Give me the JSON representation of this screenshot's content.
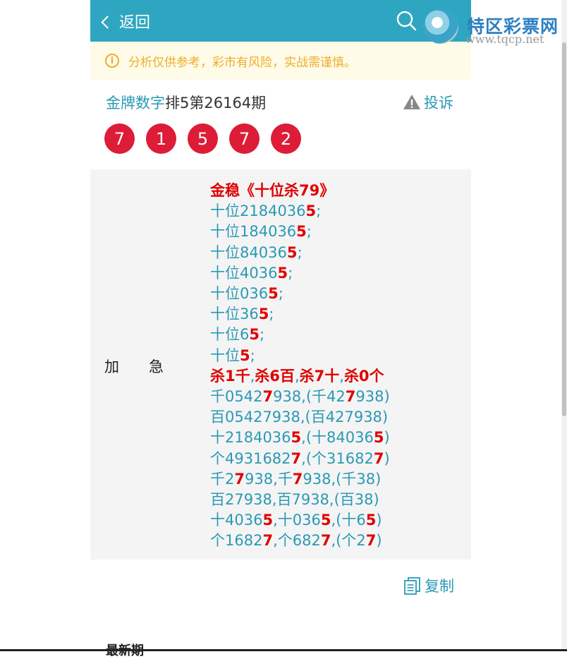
{
  "header": {
    "back_label": "返回"
  },
  "logo": {
    "name": "特区彩票网",
    "url": "www.tqcp.net"
  },
  "notice": {
    "text": "分析仅供参考，彩市有风险，实战需谨慎。"
  },
  "title": {
    "source": "金牌数字",
    "rest": "排5第26164期"
  },
  "complain_label": "投诉",
  "balls": [
    "7",
    "1",
    "5",
    "7",
    "2"
  ],
  "label": {
    "char1": "加",
    "char2": "急"
  },
  "content": {
    "heading": "金稳《十位杀79》",
    "lines": [
      {
        "a": "十位2184036",
        "r": "5",
        "b": ";"
      },
      {
        "a": "十位184036",
        "r": "5",
        "b": ";"
      },
      {
        "a": "十位84036",
        "r": "5",
        "b": ";"
      },
      {
        "a": "十位4036",
        "r": "5",
        "b": ";"
      },
      {
        "a": "十位036",
        "r": "5",
        "b": ";"
      },
      {
        "a": "十位36",
        "r": "5",
        "b": ";"
      },
      {
        "a": "十位6",
        "r": "5",
        "b": ";"
      },
      {
        "a": "十位",
        "r": "5",
        "b": ";"
      }
    ],
    "kill": {
      "k1": "杀1千",
      "s1": ",",
      "k2": "杀6百",
      "s2": ",",
      "k3": "杀7十",
      "s3": ",",
      "k4": "杀0个"
    },
    "rows": [
      {
        "p1": "千0542",
        "r1": "7",
        "p2": "938,(千42",
        "r2": "7",
        "p3": "938)"
      },
      {
        "p1": "百05427938,(百427938)"
      },
      {
        "p1": "十2184036",
        "r1": "5",
        "p2": ",(十84036",
        "r2": "5",
        "p3": ")"
      },
      {
        "p1": "个4931682",
        "r1": "7",
        "p2": ",(个31682",
        "r2": "7",
        "p3": ")"
      },
      {
        "p1": "千2",
        "r1": "7",
        "p2": "938,千",
        "r2": "7",
        "p3": "938,(千38)"
      },
      {
        "p1": "百27938,百7938,(百38)"
      },
      {
        "p1": "十4036",
        "r1": "5",
        "p2": ",十036",
        "r2": "5",
        "p3": ",(十6",
        "r3": "5",
        "p4": ")"
      },
      {
        "p1": "个1682",
        "r1": "7",
        "p2": ",个682",
        "r2": "7",
        "p3": ",(个2",
        "r3": "7",
        "p4": ")"
      }
    ]
  },
  "copy_label": "复制",
  "bottom_hint": "最新期",
  "colors": {
    "header": "#2fa6c1",
    "accent": "#2a9ab5",
    "ball": "#dd1c38",
    "highlight": "#e00000",
    "notice_bg": "#fefbe8",
    "notice_text": "#f0ad2c"
  }
}
